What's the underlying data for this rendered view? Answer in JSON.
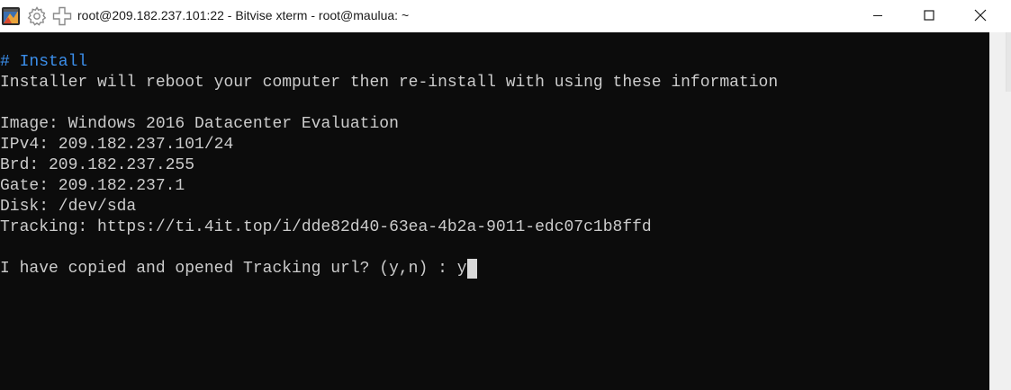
{
  "window": {
    "title": "root@209.182.237.101:22 - Bitvise xterm - root@maulua: ~"
  },
  "titlebar_icons": {
    "app": "bitvise-app-icon",
    "settings": "gear-icon",
    "new_terminal": "new-terminal-icon"
  },
  "window_controls": {
    "minimize": "minimize-icon",
    "maximize": "maximize-icon",
    "close": "close-icon"
  },
  "terminal": {
    "lines": [
      "# Install",
      "Installer will reboot your computer then re-install with using these information",
      "",
      "Image: Windows 2016 Datacenter Evaluation",
      "IPv4: 209.182.237.101/24",
      "Brd: 209.182.237.255",
      "Gate: 209.182.237.1",
      "Disk: /dev/sda",
      "Tracking: https://ti.4it.top/i/dde82d40-63ea-4b2a-9011-edc07c1b8ffd",
      "",
      "I have copied and opened Tracking url? (y,n) : ",
      "y"
    ]
  },
  "colors": {
    "terminal_bg": "#0c0c0c",
    "terminal_text": "#cccccc",
    "heading_text": "#3b8eea"
  }
}
